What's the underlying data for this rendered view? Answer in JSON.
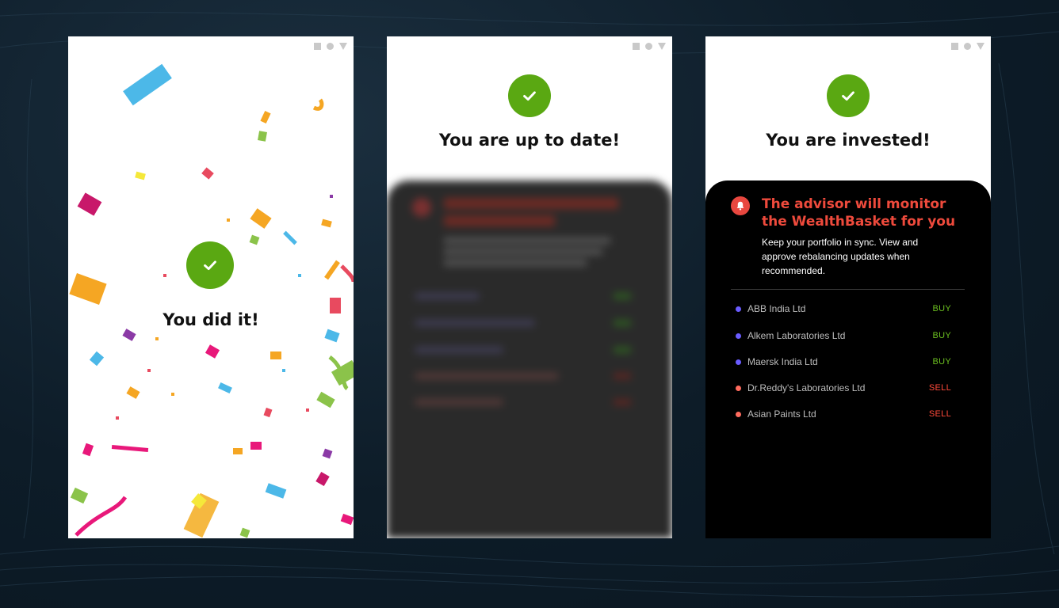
{
  "screens": [
    {
      "headline": "You did it!"
    },
    {
      "headline": "You are up to date!",
      "card": {
        "title": "The advisor will monitor the WealthBasket for you",
        "body": "Keep your portfolio in sync. View and approve rebalancing updates when recommended."
      }
    },
    {
      "headline": "You are invested!",
      "card": {
        "title": "The advisor will monitor the WealthBasket for you",
        "body": "Keep your portfolio in sync. View and approve rebalancing updates when recommended.",
        "stocks": [
          {
            "name": "ABB India Ltd",
            "action": "BUY"
          },
          {
            "name": "Alkem Laboratories Ltd",
            "action": "BUY"
          },
          {
            "name": "Maersk India Ltd",
            "action": "BUY"
          },
          {
            "name": "Dr.Reddy's Laboratories Ltd",
            "action": "SELL"
          },
          {
            "name": "Asian Paints Ltd",
            "action": "SELL"
          }
        ]
      }
    }
  ],
  "icons": {
    "status": [
      "square-icon",
      "circle-icon",
      "triangle-icon"
    ],
    "success": "check-icon",
    "notice": "bell-icon"
  },
  "colors": {
    "success": "#5aa812",
    "buy": "#6cc020",
    "sell": "#ff4a3a",
    "alert": "#ee4a3c",
    "dot_buy": "#6a5cff",
    "dot_sell": "#ff6b5e"
  }
}
